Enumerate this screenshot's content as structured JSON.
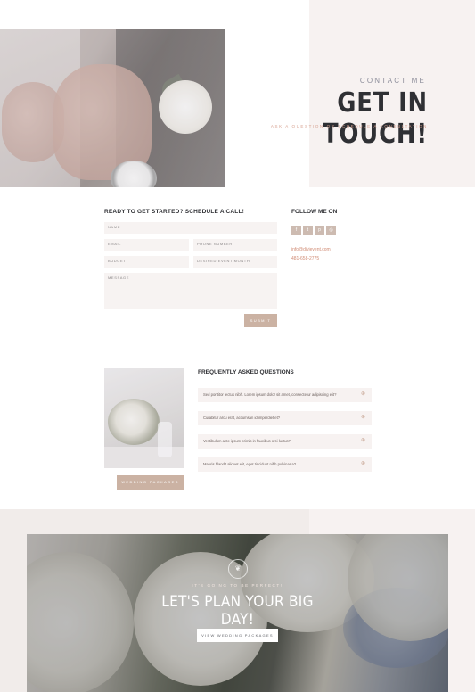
{
  "hero": {
    "eyebrow": "CONTACT ME",
    "title": "GET IN TOUCH!",
    "subtitle": "ASK A QUESTION OR SCHEDULE A CONSULTATION"
  },
  "form": {
    "title": "READY TO GET STARTED? SCHEDULE A CALL!",
    "fields": {
      "name": "NAME",
      "email": "EMAIL",
      "phone": "PHONE NUMBER",
      "budget": "BUDGET",
      "month": "DESIRED EVENT MONTH",
      "message": "MESSAGE"
    },
    "submit_label": "SUBMIT"
  },
  "follow": {
    "title": "FOLLOW ME ON",
    "socials": [
      "f",
      "t",
      "p",
      "◎"
    ],
    "email": "info@divievent.com",
    "phone": "481-658-2775"
  },
  "faq": {
    "title": "FREQUENTLY ASKED QUESTIONS",
    "items": [
      "Sed porttitor lectus nibh. Lorem ipsum dolor sit amet, consectetur adipiscing elit?",
      "Curabitur arcu erat, accumsan id imperdiet et?",
      "Vestibulum ante ipsum primis in faucibus orci luctus?",
      "Mauris blandit aliquet elit, eget tincidunt nibh pulvinar a?"
    ],
    "packages_label": "WEDDING PACKAGES"
  },
  "cta": {
    "eyebrow": "IT'S GOING TO BE PERFECT!",
    "title": "LET'S PLAN YOUR BIG DAY!",
    "button_label": "VIEW WEDDING PACKAGES"
  },
  "colors": {
    "accent": "#cbb2a3",
    "link": "#d08a73",
    "heading": "#2f3034",
    "panel": "#f7f2f1"
  }
}
